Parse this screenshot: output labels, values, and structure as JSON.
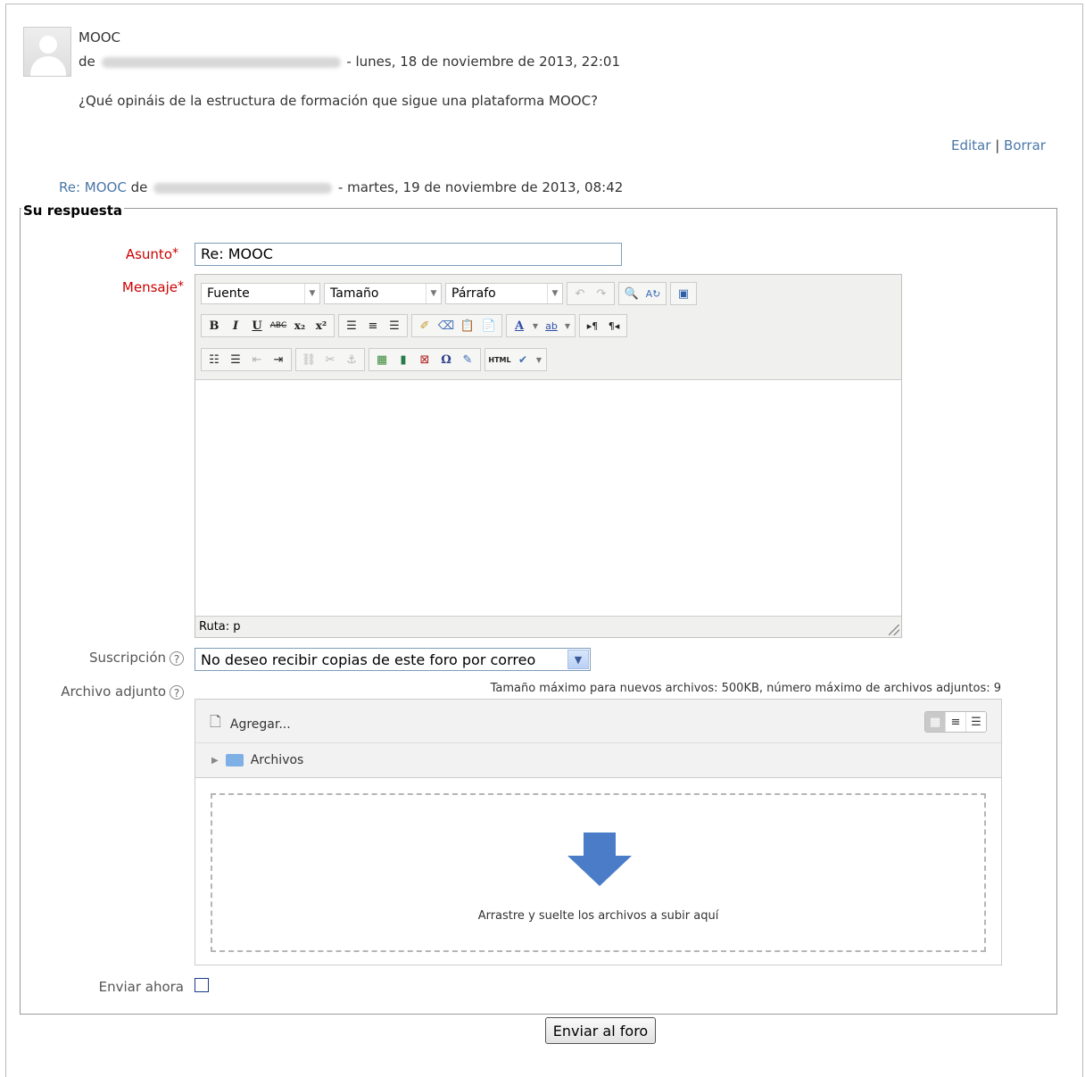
{
  "post": {
    "subject": "MOOC",
    "by_prefix": "de",
    "date": "- lunes, 18 de noviembre de 2013, 22:01",
    "body": "¿Qué opináis de la estructura de formación que sigue una plataforma MOOC?",
    "edit_label": "Editar",
    "separator": "|",
    "delete_label": "Borrar"
  },
  "reply_ref": {
    "subject": "Re: MOOC",
    "by_prefix": "de",
    "date": "- martes, 19 de noviembre de 2013, 08:42"
  },
  "form": {
    "legend": "Su respuesta",
    "subject_label": "Asunto",
    "subject_value": "Re: MOOC",
    "message_label": "Mensaje",
    "required_marker": "*",
    "editor": {
      "font_combo": "Fuente",
      "size_combo": "Tamaño",
      "format_combo": "Párrafo",
      "path_text": "Ruta: p"
    },
    "subscription_label": "Suscripción",
    "subscription_value": "No deseo recibir copias de este foro por correo",
    "attachment_label": "Archivo adjunto",
    "help_icon": "?",
    "max_info": "Tamaño máximo para nuevos archivos: 500KB, número máximo de archivos adjuntos: 9",
    "add_label": "Agregar...",
    "folder_label": "Archivos",
    "drop_message": "Arrastre y suelte los archivos a subir aquí",
    "send_now_label": "Enviar ahora",
    "submit_label": "Enviar al foro"
  },
  "colors": {
    "link": "#4a76a8",
    "required": "#cc0000",
    "drop_arrow": "#4a7cc8"
  }
}
